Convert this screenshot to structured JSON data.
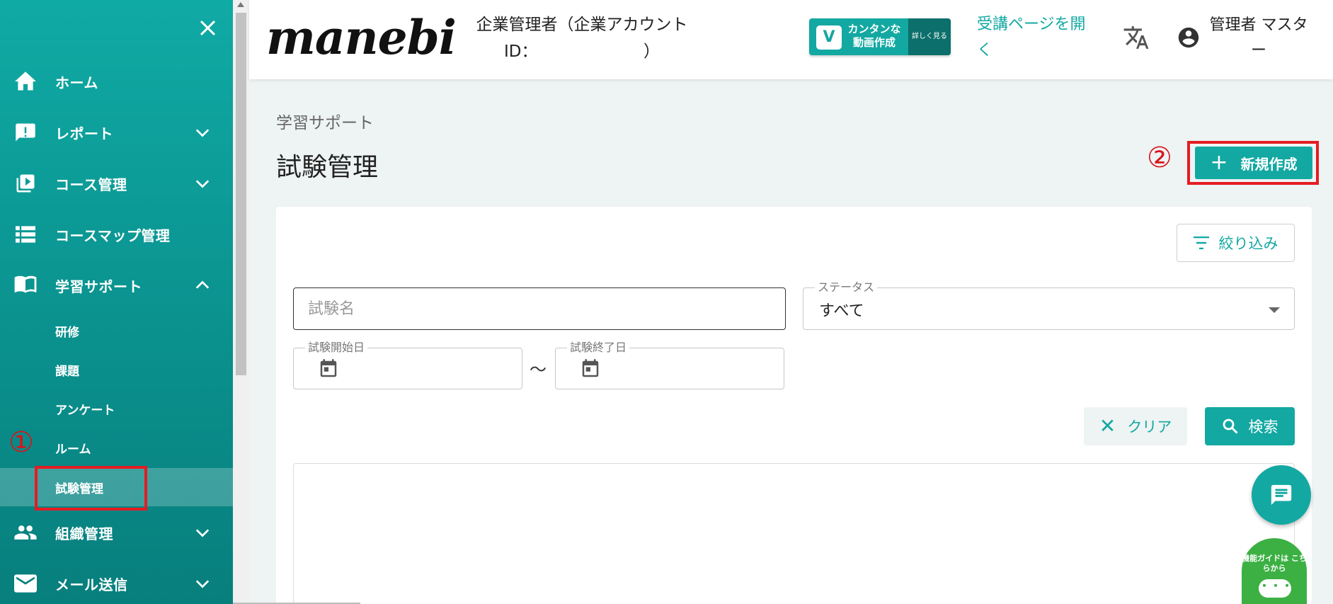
{
  "sidebar": {
    "items": [
      {
        "label": "ホーム"
      },
      {
        "label": "レポート"
      },
      {
        "label": "コース管理"
      },
      {
        "label": "コースマップ管理"
      },
      {
        "label": "学習サポート"
      },
      {
        "label": "組織管理"
      },
      {
        "label": "メール送信"
      }
    ],
    "sub_items": [
      {
        "label": "研修"
      },
      {
        "label": "課題"
      },
      {
        "label": "アンケート"
      },
      {
        "label": "ルーム"
      },
      {
        "label": "試験管理"
      }
    ],
    "active_item": "試験管理"
  },
  "header": {
    "logo": "manebi",
    "company_label": "企業管理者（企業アカウントID：　　　　　　　）",
    "promo_text": "カンタンな 動画作成",
    "promo_more": "詳しく見る",
    "learner_link": "受講ページを開く",
    "admin_name": "管理者 マスター"
  },
  "annotations": {
    "mark1": "①",
    "mark2": "②"
  },
  "main": {
    "breadcrumb": "学習サポート",
    "title": "試験管理",
    "new_button": "新規作成",
    "filter_button": "絞り込み",
    "exam_name_placeholder": "試験名",
    "status_label": "ステータス",
    "status_value": "すべて",
    "start_date_label": "試験開始日",
    "end_date_label": "試験終了日",
    "range_separator": "～",
    "clear_button": "クリア",
    "search_button": "検索"
  },
  "guide_widget": {
    "text": "機能ガイドは こちらから",
    "bubble": "・・・"
  },
  "colors": {
    "accent": "#13a8a2",
    "highlight": "#e41c22",
    "guide": "#3cb043"
  }
}
